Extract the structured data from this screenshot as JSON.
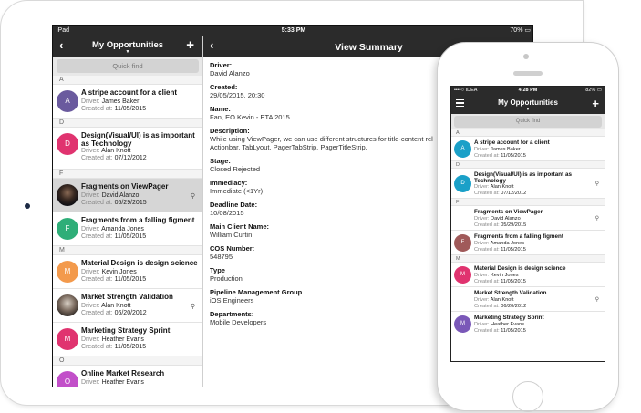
{
  "ipad": {
    "status": {
      "left": "iPad",
      "time": "5:33 PM",
      "battery": "70%"
    },
    "list_pane": {
      "title": "My Opportunities",
      "back_icon": "chevron-left-icon",
      "add_icon": "plus-icon",
      "search_placeholder": "Quick find",
      "sections": [
        {
          "letter": "A",
          "items": [
            {
              "title": "A stripe account for a client",
              "driver": "James Baker",
              "created": "11/05/2015",
              "initial": "A",
              "color": "#6a5a9e",
              "pinned": false,
              "selected": false
            }
          ]
        },
        {
          "letter": "D",
          "items": [
            {
              "title": "Design(Visual/UI) is as important as Technology",
              "driver": "Alan Knott",
              "created": "07/12/2012",
              "initial": "D",
              "color": "#e0336f",
              "pinned": false,
              "selected": false
            }
          ]
        },
        {
          "letter": "F",
          "items": [
            {
              "title": "Fragments on ViewPager",
              "driver": "David Alanzo",
              "created": "05/29/2015",
              "initial": "",
              "color": "photo-dark",
              "pinned": true,
              "selected": true
            },
            {
              "title": "Fragments from a falling figment",
              "driver": "Amanda Jones",
              "created": "11/05/2015",
              "initial": "F",
              "color": "#2eae78",
              "pinned": false,
              "selected": false
            }
          ]
        },
        {
          "letter": "M",
          "items": [
            {
              "title": "Material Design is design science",
              "driver": "Kevin Jones",
              "created": "11/05/2015",
              "initial": "M",
              "color": "#f39a4c",
              "pinned": false,
              "selected": false
            },
            {
              "title": "Market Strength Validation",
              "driver": "Alan Knott",
              "created": "06/20/2012",
              "initial": "",
              "color": "photo-light",
              "pinned": true,
              "selected": false
            },
            {
              "title": "Marketing Strategy Sprint",
              "driver": "Heather Evans",
              "created": "11/05/2015",
              "initial": "M",
              "color": "#e0336f",
              "pinned": false,
              "selected": false
            }
          ]
        },
        {
          "letter": "O",
          "items": [
            {
              "title": "Online Market Research",
              "driver": "Heather Evans",
              "created": "",
              "initial": "O",
              "color": "#c24fc9",
              "pinned": false,
              "selected": false
            }
          ]
        }
      ],
      "driver_label": "Driver:",
      "created_label": "Created at:"
    },
    "detail_pane": {
      "title": "View Summary",
      "back_icon": "chevron-left-icon",
      "fields": [
        {
          "label": "Driver:",
          "value": "David Alanzo"
        },
        {
          "label": "Created:",
          "value": "29/05/2015, 20:30"
        },
        {
          "label": "Name:",
          "value": "Fan, EO Kevin - ETA 2015"
        },
        {
          "label": "Description:",
          "value": "While using ViewPager, we can use different structures for title-content rel",
          "value2": "Actionbar, TabLyout, PagerTabStrip, PagerTitleStrip."
        },
        {
          "label": "Stage:",
          "value": "Closed Rejected"
        },
        {
          "label": "Immediacy:",
          "value": "Immediate (<1Yr)"
        },
        {
          "label": "Deadline Date:",
          "value": "10/08/2015"
        },
        {
          "label": "Main Client Name:",
          "value": "William Curtin"
        },
        {
          "label": "COS Number:",
          "value": "548795"
        },
        {
          "label": "Type",
          "value": "Production"
        },
        {
          "label": "Pipeline Management Group",
          "value": "iOS Engineers"
        },
        {
          "label": "Departments:",
          "value": "Mobile Developers"
        }
      ]
    }
  },
  "iphone": {
    "status": {
      "left": "IDEA",
      "time": "4:28 PM",
      "battery": "82%"
    },
    "title": "My Opportunities",
    "menu_icon": "hamburger-menu-icon",
    "add_icon": "plus-icon",
    "search_placeholder": "Quick find",
    "driver_label": "Driver:",
    "created_label": "Created at:",
    "sections": [
      {
        "letter": "A",
        "items": [
          {
            "title": "A stripe account for a client",
            "driver": "James Baker",
            "created": "11/05/2015",
            "initial": "A",
            "color": "#1aa0c8",
            "pinned": false,
            "tall": false
          }
        ]
      },
      {
        "letter": "D",
        "items": [
          {
            "title": "Design(Visual/UI) is as important as Technology",
            "driver": "Alan Knott",
            "created": "07/12/2012",
            "initial": "D",
            "color": "#1aa0c8",
            "pinned": true,
            "tall": true
          }
        ]
      },
      {
        "letter": "F",
        "items": [
          {
            "title": "Fragments on ViewPager",
            "driver": "David Alanzo",
            "created": "05/29/2015",
            "initial": "",
            "color": "photo-dark",
            "pinned": true,
            "tall": false
          },
          {
            "title": "Fragments from a falling figment",
            "driver": "Amanda Jones",
            "created": "11/05/2015",
            "initial": "F",
            "color": "#a05a5a",
            "pinned": false,
            "tall": false
          }
        ]
      },
      {
        "letter": "M",
        "items": [
          {
            "title": "Material Design is design science",
            "driver": "Kevin Jones",
            "created": "11/05/2015",
            "initial": "M",
            "color": "#e0336f",
            "pinned": false,
            "tall": false
          },
          {
            "title": "Market Strength Validation",
            "driver": "Alan Knott",
            "created": "06/20/2012",
            "initial": "",
            "color": "photo-light",
            "pinned": true,
            "tall": false
          },
          {
            "title": "Marketing Strategy Sprint",
            "driver": "Heather Evans",
            "created": "11/05/2015",
            "initial": "M",
            "color": "#7a58b8",
            "pinned": false,
            "tall": false
          }
        ]
      }
    ]
  }
}
